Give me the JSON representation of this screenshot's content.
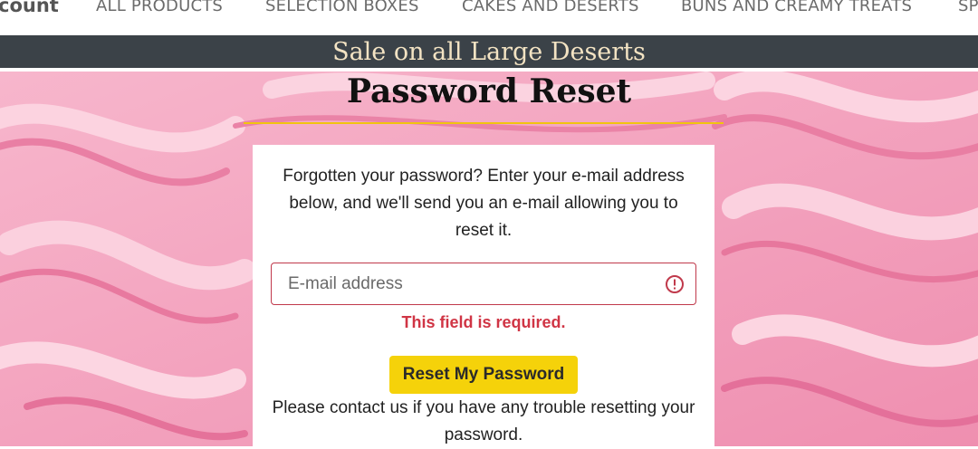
{
  "nav": {
    "account_label": "count",
    "items": [
      {
        "label": "ALL PRODUCTS"
      },
      {
        "label": "SELECTION BOXES"
      },
      {
        "label": "CAKES AND DESERTS"
      },
      {
        "label": "BUNS AND CREAMY TREATS"
      },
      {
        "label": "SP"
      }
    ]
  },
  "banner": {
    "text": "Sale on all Large Deserts"
  },
  "page": {
    "title": "Password Reset",
    "intro": "Forgotten your password? Enter your e-mail address below, and we'll send you an e-mail allowing you to reset it.",
    "email_placeholder": "E-mail address",
    "email_value": "",
    "error": "This field is required.",
    "reset_button": "Reset My Password",
    "contact": "Please contact us if you have any trouble resetting your password."
  },
  "colors": {
    "banner_bg": "#3b4248",
    "banner_text": "#f3e3c3",
    "accent_yellow": "#f5d20a",
    "error_red": "#d03545",
    "background_pink": "#f4a9c3"
  },
  "icons": {
    "field_alert": "alert-circle-icon"
  }
}
